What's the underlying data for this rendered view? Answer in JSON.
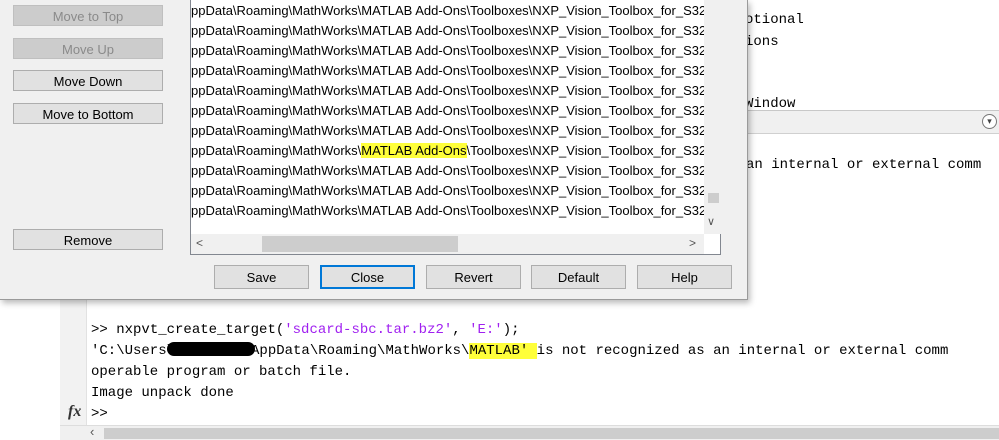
{
  "dialog": {
    "side_buttons": {
      "move_to_top": "Move to Top",
      "move_up": "Move Up",
      "move_down": "Move Down",
      "move_to_bottom": "Move to Bottom",
      "remove": "Remove"
    },
    "path_list": {
      "rows": [
        {
          "pre": "ppData\\Roaming\\MathWorks\\",
          "hl": "",
          "post": "MATLAB Add-Ons\\Toolboxes\\NXP_Vision_Toolbox_for_S32"
        },
        {
          "pre": "ppData\\Roaming\\MathWorks\\",
          "hl": "",
          "post": "MATLAB Add-Ons\\Toolboxes\\NXP_Vision_Toolbox_for_S32"
        },
        {
          "pre": "ppData\\Roaming\\MathWorks\\",
          "hl": "",
          "post": "MATLAB Add-Ons\\Toolboxes\\NXP_Vision_Toolbox_for_S32"
        },
        {
          "pre": "ppData\\Roaming\\MathWorks\\",
          "hl": "",
          "post": "MATLAB Add-Ons\\Toolboxes\\NXP_Vision_Toolbox_for_S32"
        },
        {
          "pre": "ppData\\Roaming\\MathWorks\\",
          "hl": "",
          "post": "MATLAB Add-Ons\\Toolboxes\\NXP_Vision_Toolbox_for_S32"
        },
        {
          "pre": "ppData\\Roaming\\MathWorks\\",
          "hl": "",
          "post": "MATLAB Add-Ons\\Toolboxes\\NXP_Vision_Toolbox_for_S32"
        },
        {
          "pre": "ppData\\Roaming\\MathWorks\\",
          "hl": "",
          "post": "MATLAB Add-Ons\\Toolboxes\\NXP_Vision_Toolbox_for_S32"
        },
        {
          "pre": "ppData\\Roaming\\MathWorks\\",
          "hl": "MATLAB Add-Ons",
          "post": "\\Toolboxes\\NXP_Vision_Toolbox_for_S32"
        },
        {
          "pre": "ppData\\Roaming\\MathWorks\\",
          "hl": "",
          "post": "MATLAB Add-Ons\\Toolboxes\\NXP_Vision_Toolbox_for_S32"
        },
        {
          "pre": "ppData\\Roaming\\MathWorks\\",
          "hl": "",
          "post": "MATLAB Add-Ons\\Toolboxes\\NXP_Vision_Toolbox_for_S32"
        },
        {
          "pre": "ppData\\Roaming\\MathWorks\\",
          "hl": "",
          "post": "MATLAB Add-Ons\\Toolboxes\\NXP_Vision_Toolbox_for_S32"
        }
      ]
    },
    "buttons": {
      "save": "Save",
      "close": "Close",
      "revert": "Revert",
      "default": "Default",
      "help": "Help"
    }
  },
  "background": {
    "right_text": [
      "otional",
      "ions",
      "Window"
    ],
    "right_continuation": "an internal or external comm",
    "command_window": {
      "line1": {
        "prompt": ">> ",
        "func": "nxpvt_create_target(",
        "arg1": "'sdcard-sbc.tar.bz2'",
        "sep": ", ",
        "arg2": "'E:'",
        "end": ");"
      },
      "line2": {
        "pre": "'C:\\Users\\",
        "mid": "AppData\\Roaming\\MathWorks\\",
        "hl": "MATLAB' ",
        "post": "is not recognized as an internal or external comm"
      },
      "line3": "operable program or batch file.",
      "line4": "Image unpack done",
      "line5": ">>"
    }
  },
  "icons": {
    "fx": "fx",
    "dropdown": "chevron-down-icon"
  },
  "colors": {
    "highlight": "#ffff3a",
    "string": "#a020f0",
    "focus": "#0078d7"
  }
}
